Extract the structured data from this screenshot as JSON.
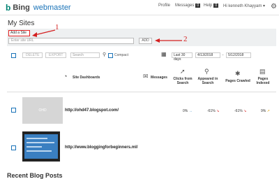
{
  "app": {
    "logo_b": "b",
    "logo_bing": "Bing",
    "logo_product": "webmaster"
  },
  "header_nav": {
    "profile": "Profile",
    "messages": "Messages",
    "messages_count": "0",
    "help": "Help",
    "help_count": "0",
    "user": "Hi kenneth Khayyam ▾"
  },
  "page_title": "My Sites",
  "add_panel": {
    "add_site_label": "Add a Site",
    "url_placeholder": "Enter site URL",
    "add_button": "ADD"
  },
  "annotations": {
    "callout_1": "1",
    "callout_2": "2"
  },
  "toolbar": {
    "delete": "DELETE",
    "export": "EXPORT",
    "search_placeholder": "Search",
    "compact": "Compact",
    "date_range": "Last 30 days",
    "date_from": "4/13/2018",
    "date_sep": "–",
    "date_to": "5/12/2018"
  },
  "columns": {
    "site_dashboards": "Site Dashboards",
    "messages": "Messages",
    "clicks": "Clicks from Search",
    "appeared": "Appeared in Search",
    "crawled": "Pages Crawled",
    "indexed": "Pages Indexed"
  },
  "sites": [
    {
      "thumb_label": "OHD",
      "url": "http://ohd47.blogspot.com/",
      "clicks": "0%",
      "clicks_dir": "→",
      "appeared": "-61%",
      "appeared_dir": "↘",
      "crawled": "-61%",
      "crawled_dir": "↘",
      "indexed": "9%",
      "indexed_dir": "↗"
    },
    {
      "thumb_label": "",
      "url": "http://www.bloggingforbeginners.ml/",
      "clicks": "",
      "appeared": "",
      "crawled": "",
      "indexed": ""
    }
  ],
  "footer_heading": "Recent Blog Posts",
  "colors": {
    "accent": "#1a73b8",
    "alert": "#d42020",
    "logo": "#008373"
  }
}
